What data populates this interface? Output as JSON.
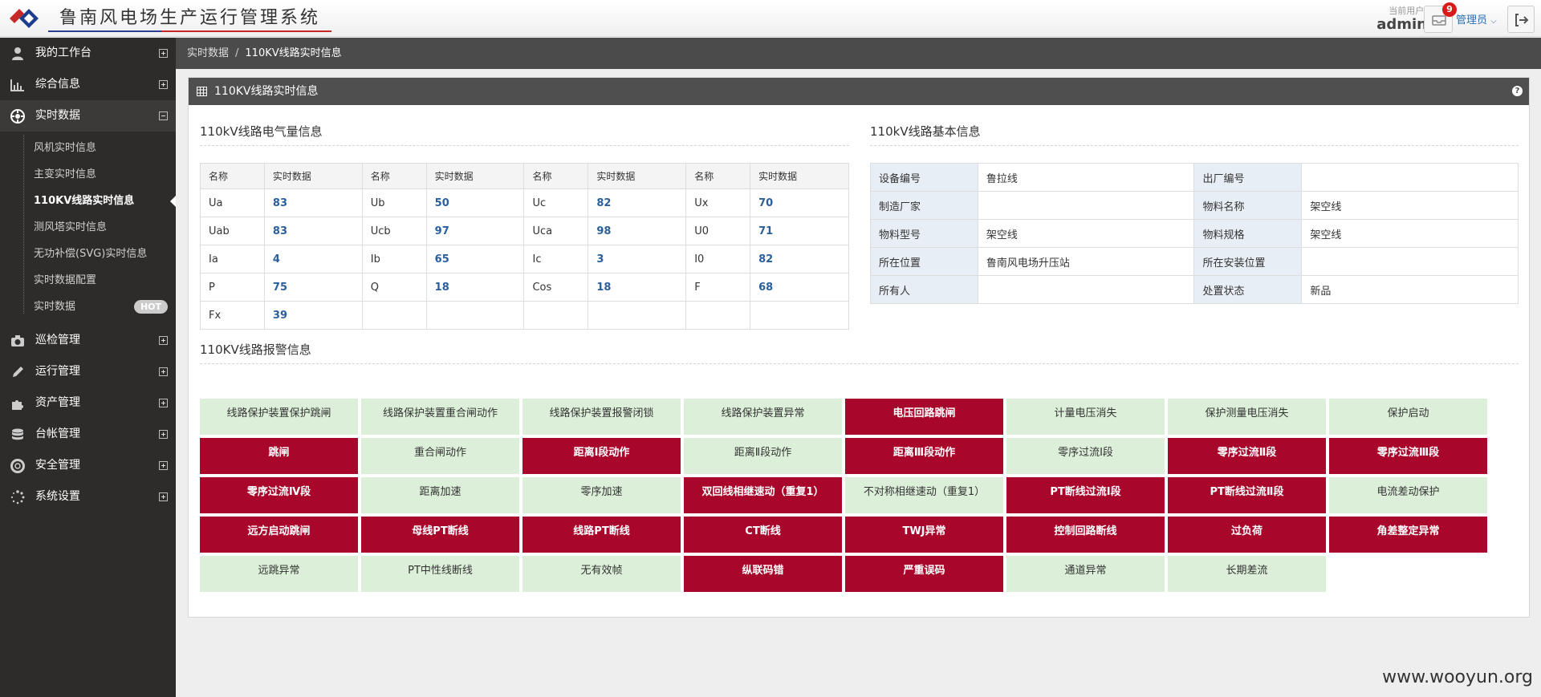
{
  "header": {
    "app_title": "鲁南风电场生产运行管理系统",
    "user_label": "当前用户:",
    "user_name": "admin",
    "notification_count": "9",
    "role_menu": "管理员",
    "colors": {
      "title_underline_blue": "#2b3f8e",
      "title_underline_red": "#c62828",
      "badge": "#d71a1a"
    }
  },
  "sidebar": {
    "items": [
      {
        "label": "我的工作台",
        "icon": "user-icon"
      },
      {
        "label": "综合信息",
        "icon": "bar-chart-icon"
      },
      {
        "label": "实时数据",
        "icon": "gear-icon"
      },
      {
        "label": "巡检管理",
        "icon": "camera-icon"
      },
      {
        "label": "运行管理",
        "icon": "pencil-icon"
      },
      {
        "label": "资产管理",
        "icon": "puzzle-icon"
      },
      {
        "label": "台帐管理",
        "icon": "database-icon"
      },
      {
        "label": "安全管理",
        "icon": "lifebuoy-icon"
      },
      {
        "label": "系统设置",
        "icon": "spinner-icon"
      }
    ],
    "subitems": [
      {
        "label": "风机实时信息"
      },
      {
        "label": "主变实时信息"
      },
      {
        "label": "110KV线路实时信息"
      },
      {
        "label": "测风塔实时信息"
      },
      {
        "label": "无功补偿(SVG)实时信息"
      },
      {
        "label": "实时数据配置"
      },
      {
        "label": "实时数据"
      }
    ],
    "hot_badge": "HOT"
  },
  "breadcrumb": {
    "parent": "实时数据",
    "separator": "/",
    "current": "110KV线路实时信息"
  },
  "panel": {
    "title": "110KV线路实时信息",
    "help": "?",
    "electrical": {
      "title": "110kV线路电气量信息",
      "headers": [
        "名称",
        "实时数据",
        "名称",
        "实时数据",
        "名称",
        "实时数据",
        "名称",
        "实时数据"
      ],
      "rows": [
        [
          "Ua",
          "83",
          "Ub",
          "50",
          "Uc",
          "82",
          "Ux",
          "70"
        ],
        [
          "Uab",
          "83",
          "Ucb",
          "97",
          "Uca",
          "98",
          "U0",
          "71"
        ],
        [
          "Ia",
          "4",
          "Ib",
          "65",
          "Ic",
          "3",
          "I0",
          "82"
        ],
        [
          "P",
          "75",
          "Q",
          "18",
          "Cos",
          "18",
          "F",
          "68"
        ],
        [
          "Fx",
          "39",
          "",
          "",
          "",
          "",
          "",
          ""
        ]
      ]
    },
    "basic": {
      "title": "110kV线路基本信息",
      "rows": [
        [
          "设备编号",
          "鲁拉线",
          "出厂编号",
          ""
        ],
        [
          "制造厂家",
          "",
          "物料名称",
          "架空线"
        ],
        [
          "物料型号",
          "架空线",
          "物料规格",
          "架空线"
        ],
        [
          "所在位置",
          "鲁南风电场升压站",
          "所在安装位置",
          ""
        ],
        [
          "所有人",
          "",
          "处置状态",
          "新品"
        ]
      ]
    },
    "alarms": {
      "title": "110KV线路报警信息",
      "colors": {
        "normal": "#dcefd9",
        "alarm": "#a8072b"
      },
      "items": [
        {
          "label": "线路保护装置保护跳闸",
          "state": "ok"
        },
        {
          "label": "线路保护装置重合闸动作",
          "state": "ok"
        },
        {
          "label": "线路保护装置报警闭锁",
          "state": "ok"
        },
        {
          "label": "线路保护装置异常",
          "state": "ok"
        },
        {
          "label": "电压回路跳闸",
          "state": "err"
        },
        {
          "label": "计量电压消失",
          "state": "ok"
        },
        {
          "label": "保护测量电压消失",
          "state": "ok"
        },
        {
          "label": "保护启动",
          "state": "ok"
        },
        {
          "label": "跳闸",
          "state": "err"
        },
        {
          "label": "重合闸动作",
          "state": "ok"
        },
        {
          "label": "距离Ⅰ段动作",
          "state": "err"
        },
        {
          "label": "距离Ⅱ段动作",
          "state": "ok"
        },
        {
          "label": "距离Ⅲ段动作",
          "state": "err"
        },
        {
          "label": "零序过流Ⅰ段",
          "state": "ok"
        },
        {
          "label": "零序过流Ⅱ段",
          "state": "err"
        },
        {
          "label": "零序过流Ⅲ段",
          "state": "err"
        },
        {
          "label": "零序过流Ⅳ段",
          "state": "err"
        },
        {
          "label": "距离加速",
          "state": "ok"
        },
        {
          "label": "零序加速",
          "state": "ok"
        },
        {
          "label": "双回线相继速动（重复1）",
          "state": "err"
        },
        {
          "label": "不对称相继速动（重复1）",
          "state": "ok"
        },
        {
          "label": "PT断线过流Ⅰ段",
          "state": "err"
        },
        {
          "label": "PT断线过流Ⅱ段",
          "state": "err"
        },
        {
          "label": "电流差动保护",
          "state": "ok"
        },
        {
          "label": "远方启动跳闸",
          "state": "err"
        },
        {
          "label": "母线PT断线",
          "state": "err"
        },
        {
          "label": "线路PT断线",
          "state": "err"
        },
        {
          "label": "CT断线",
          "state": "err"
        },
        {
          "label": "TWJ异常",
          "state": "err"
        },
        {
          "label": "控制回路断线",
          "state": "err"
        },
        {
          "label": "过负荷",
          "state": "err"
        },
        {
          "label": "角差整定异常",
          "state": "err"
        },
        {
          "label": "远跳异常",
          "state": "ok"
        },
        {
          "label": "PT中性线断线",
          "state": "ok"
        },
        {
          "label": "无有效帧",
          "state": "ok"
        },
        {
          "label": "纵联码错",
          "state": "err"
        },
        {
          "label": "严重误码",
          "state": "err"
        },
        {
          "label": "通道异常",
          "state": "ok"
        },
        {
          "label": "长期差流",
          "state": "ok"
        }
      ]
    }
  },
  "watermark": "www.wooyun.org"
}
